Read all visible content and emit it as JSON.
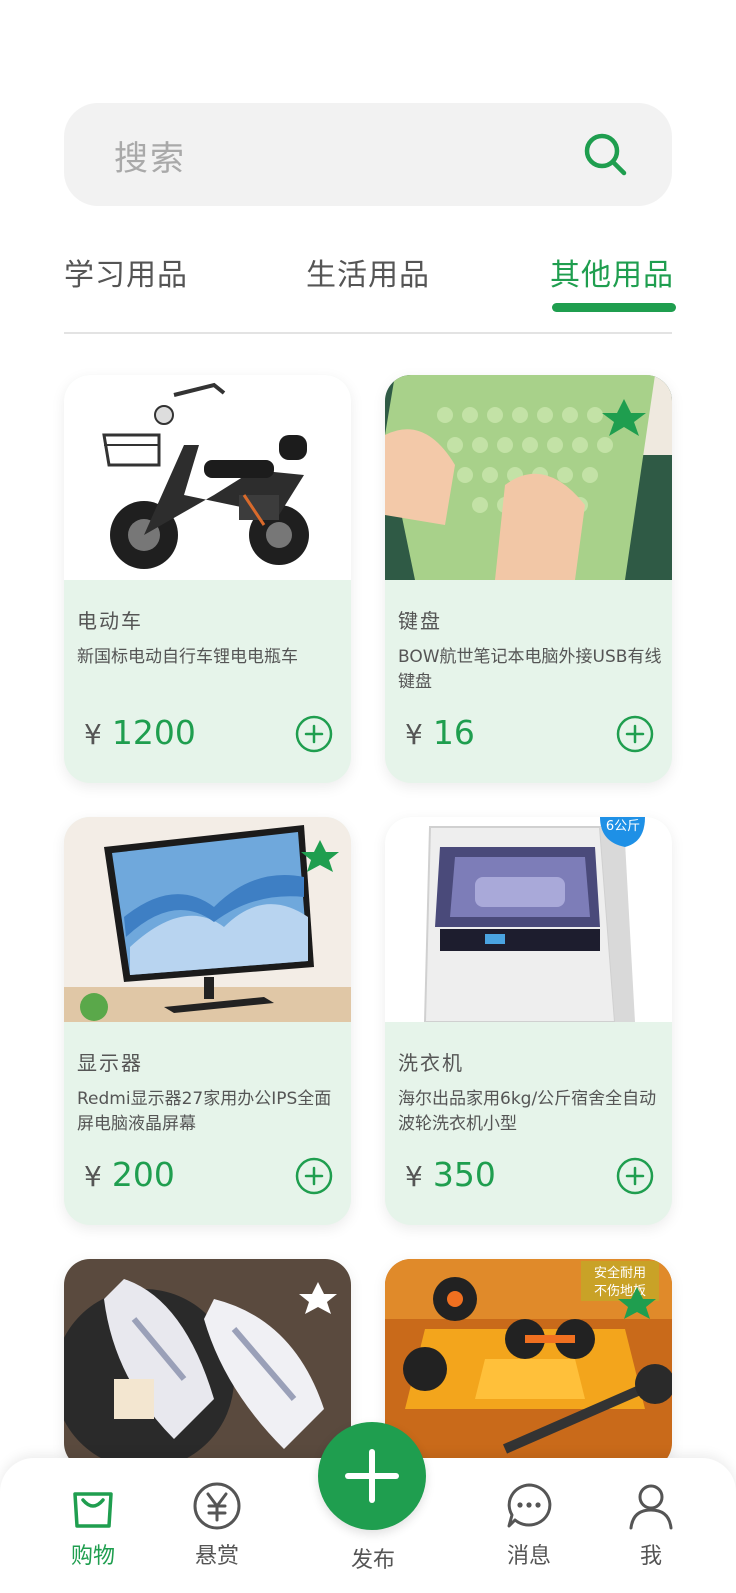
{
  "search": {
    "placeholder": "搜索"
  },
  "tabs": [
    {
      "label": "学习用品",
      "active": false
    },
    {
      "label": "生活用品",
      "active": false
    },
    {
      "label": "其他用品",
      "active": true
    }
  ],
  "products": [
    {
      "category": "电动车",
      "title": "新国标电动自行车锂电电瓶车",
      "currency": "¥",
      "price": "1200",
      "image": "electric-bike"
    },
    {
      "category": "键盘",
      "title": "BOW航世笔记本电脑外接USB有线键盘",
      "currency": "¥",
      "price": "16",
      "image": "green-keyboard"
    },
    {
      "category": "显示器",
      "title": "Redmi显示器27家用办公IPS全面屏电脑液晶屏幕",
      "currency": "¥",
      "price": "200",
      "image": "monitor"
    },
    {
      "category": "洗衣机",
      "title": "海尔出品家用6kg/公斤宿舍全自动波轮洗衣机小型",
      "currency": "¥",
      "price": "350",
      "image": "washing-machine",
      "image_badge": "6公斤"
    },
    {
      "image": "sneakers"
    },
    {
      "image": "dumbbells",
      "image_badge_lines": [
        "安全耐用",
        "不伤地板"
      ]
    }
  ],
  "bottom_nav": [
    {
      "label": "购物",
      "icon": "shopping-bag-icon",
      "active": true
    },
    {
      "label": "悬赏",
      "icon": "yen-coin-icon",
      "active": false
    },
    {
      "label": "发布",
      "icon": "plus-icon",
      "active": false
    },
    {
      "label": "消息",
      "icon": "chat-bubble-icon",
      "active": false
    },
    {
      "label": "我",
      "icon": "user-icon",
      "active": false
    }
  ],
  "colors": {
    "accent": "#1f9e4f",
    "card_bg": "#e6f4ea",
    "search_bg": "#f2f2f2"
  }
}
